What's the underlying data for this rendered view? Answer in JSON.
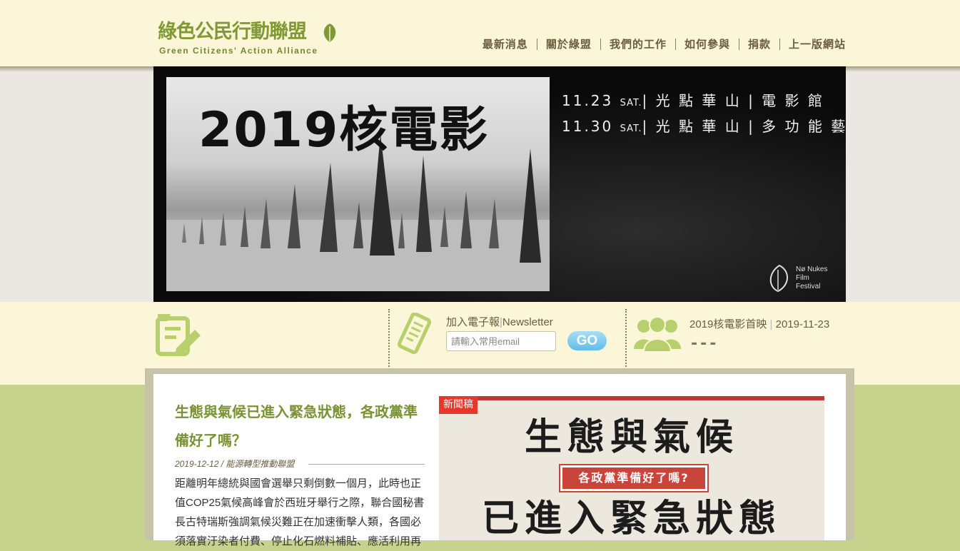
{
  "header": {
    "logo_cn": "綠色公民行動聯盟",
    "logo_en": "Green Citizens' Action Alliance",
    "nav": [
      {
        "label": "最新消息"
      },
      {
        "label": "關於綠盟"
      },
      {
        "label": "我們的工作"
      },
      {
        "label": "如何參與"
      },
      {
        "label": "捐款"
      },
      {
        "label": "上一版網站"
      }
    ]
  },
  "hero": {
    "title": "2019核電影",
    "date1": "11.23",
    "date1_day": "SAT.",
    "date1_place": "| 光 點 華 山 | 電 影 館",
    "date2": "11.30",
    "date2_day": "SAT.",
    "date2_place": "| 光 點 華 山 | 多 功 能 藝 文 廳",
    "badge_line1": "Nø Nukes",
    "badge_line2": "Film",
    "badge_line3": "Festival"
  },
  "newsletter": {
    "label": "加入電子報",
    "label_en": "Newsletter",
    "placeholder": "請輸入常用email",
    "go": "GO"
  },
  "event": {
    "title": "2019核電影首映",
    "date": "2019-11-23",
    "sub": "---"
  },
  "article": {
    "title": "生態與氣候已進入緊急狀態，各政黨準備好了嗎？",
    "meta": "2019-12-12 / 能源轉型推動聯盟",
    "body": "距離明年總統與國會選舉只剩倒數一個月，此時也正值COP25氣候高峰會於西班牙舉行之際，聯合國秘書長古特瑞斯強調氣候災難正在加速衝擊人類，各國必須落實汙染者付費、停止化石燃料補貼、應活利用再"
  },
  "news_image": {
    "tag": "新聞稿",
    "headline1": "生態與氣候",
    "ribbon": "各政黨準備好了嗎?",
    "headline2": "已進入緊急狀態"
  },
  "colors": {
    "brand_green": "#7f9a34",
    "header_bg": "#fbf6d7",
    "page_green": "#c7d38c",
    "go_blue": "#5fbde9",
    "tag_red": "#e6372a"
  }
}
